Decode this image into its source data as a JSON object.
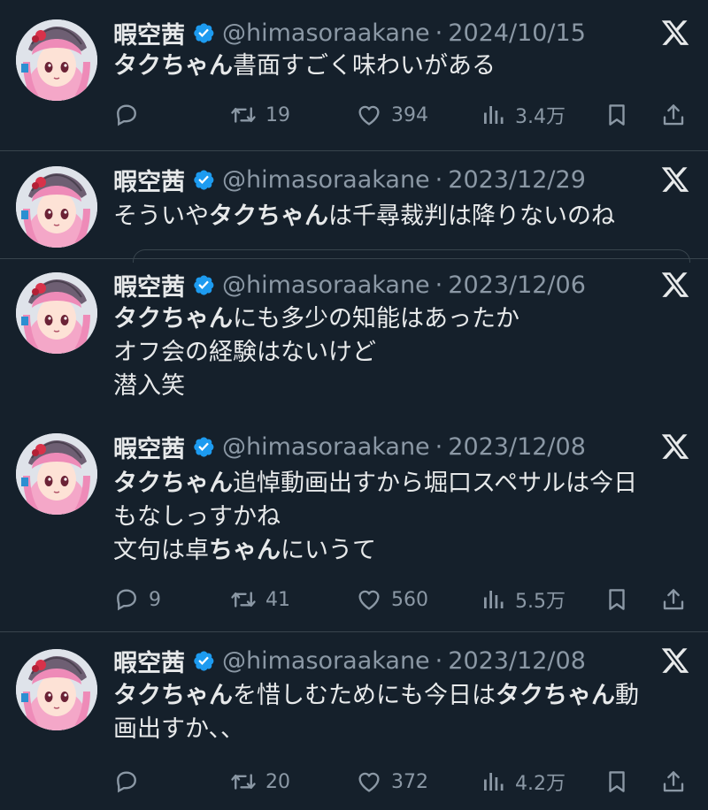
{
  "author": {
    "name": "暇空茜",
    "handle": "@himasoraakane"
  },
  "separator_dot": "·",
  "tweets": [
    {
      "date": "2024/10/15",
      "lines": [
        [
          {
            "t": "タクちゃん",
            "b": true
          },
          {
            "t": "書面すごく味わいがある",
            "b": false
          }
        ]
      ],
      "stats": {
        "replies": "",
        "retweets": "19",
        "likes": "394",
        "views": "3.4万"
      }
    },
    {
      "date": "2023/12/29",
      "lines": [
        [
          {
            "t": "そういや",
            "b": false
          },
          {
            "t": "タクちゃん",
            "b": true
          },
          {
            "t": "は千尋裁判は降りないのね",
            "b": false
          }
        ]
      ],
      "stats": null
    },
    {
      "date": "2023/12/06",
      "lines": [
        [
          {
            "t": "タクちゃん",
            "b": true
          },
          {
            "t": "にも多少の知能はあったか",
            "b": false
          }
        ],
        [
          {
            "t": "オフ会の経験はないけど",
            "b": false
          }
        ],
        [
          {
            "t": "潜入笑",
            "b": false
          }
        ]
      ],
      "stats": null
    },
    {
      "date": "2023/12/08",
      "lines": [
        [
          {
            "t": "タクちゃん",
            "b": true
          },
          {
            "t": "追悼動画出すから堀口スペサルは今日",
            "b": false
          }
        ],
        [
          {
            "t": "もなしっすかね",
            "b": false
          }
        ],
        [
          {
            "t": "文句は卓",
            "b": false
          },
          {
            "t": "ちゃん",
            "b": true
          },
          {
            "t": "にいうて",
            "b": false
          }
        ]
      ],
      "stats": {
        "replies": "9",
        "retweets": "41",
        "likes": "560",
        "views": "5.5万"
      }
    },
    {
      "date": "2023/12/08",
      "lines": [
        [
          {
            "t": "タクちゃん",
            "b": true
          },
          {
            "t": "を惜しむためにも今日は",
            "b": false
          },
          {
            "t": "タクちゃん",
            "b": true
          },
          {
            "t": "動",
            "b": false
          }
        ],
        [
          {
            "t": "画出すか、、",
            "b": false
          }
        ]
      ],
      "stats": {
        "replies": "",
        "retweets": "20",
        "likes": "372",
        "views": "4.2万"
      }
    }
  ],
  "colors": {
    "background": "#15202b",
    "text": "#e7e9ea",
    "muted": "#8b98a5",
    "verified": "#1d9bf0",
    "separator": "#38444d"
  },
  "icons": [
    "verified-badge-icon",
    "x-logo-icon",
    "reply-icon",
    "retweet-icon",
    "like-icon",
    "views-icon",
    "bookmark-icon",
    "share-icon"
  ]
}
